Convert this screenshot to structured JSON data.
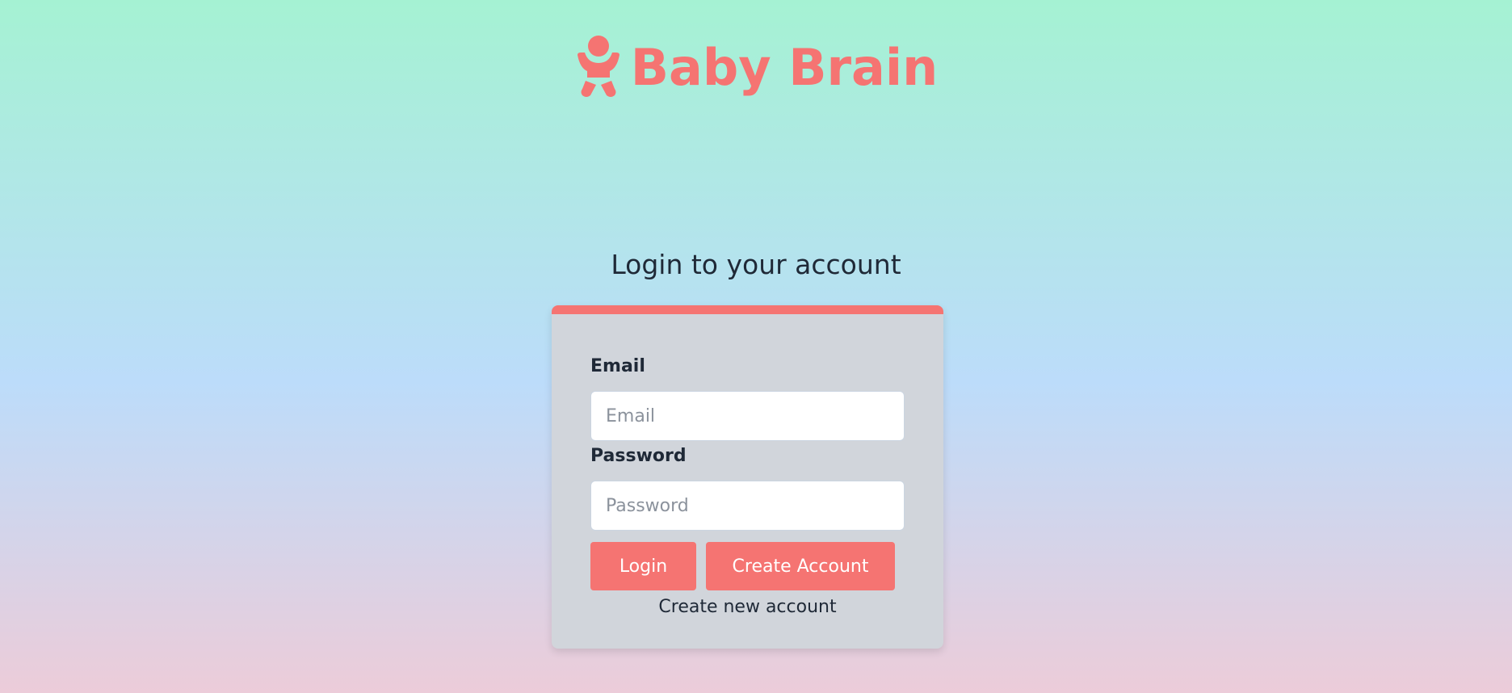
{
  "brand": {
    "name": "Baby Brain",
    "icon": "baby-icon",
    "color": "#f57472"
  },
  "heading": "Login to your account",
  "form": {
    "email": {
      "label": "Email",
      "placeholder": "Email",
      "value": ""
    },
    "password": {
      "label": "Password",
      "placeholder": "Password",
      "value": ""
    },
    "buttons": {
      "login": "Login",
      "create_account": "Create Account"
    },
    "create_link": "Create new account"
  },
  "colors": {
    "accent": "#f57472",
    "card_background": "#d1d5db",
    "text": "#1f2937"
  }
}
